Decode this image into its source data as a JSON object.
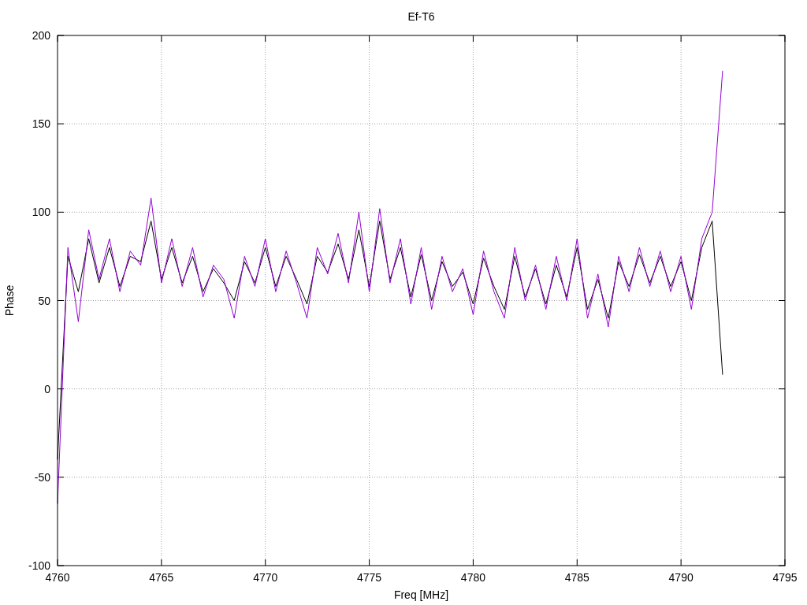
{
  "chart_data": {
    "type": "line",
    "title": "Ef-T6",
    "xlabel": "Freq [MHz]",
    "ylabel": "Phase",
    "x": [
      4760,
      4760.5,
      4761,
      4761.5,
      4762,
      4762.5,
      4763,
      4763.5,
      4764,
      4764.5,
      4765,
      4765.5,
      4766,
      4766.5,
      4767,
      4767.5,
      4768,
      4768.5,
      4769,
      4769.5,
      4770,
      4770.5,
      4771,
      4771.5,
      4772,
      4772.5,
      4773,
      4773.5,
      4774,
      4774.5,
      4775,
      4775.5,
      4776,
      4776.5,
      4777,
      4777.5,
      4778,
      4778.5,
      4779,
      4779.5,
      4780,
      4780.5,
      4781,
      4781.5,
      4782,
      4782.5,
      4783,
      4783.5,
      4784,
      4784.5,
      4785,
      4785.5,
      4786,
      4786.5,
      4787,
      4787.5,
      4788,
      4788.5,
      4789,
      4789.5,
      4790,
      4790.5,
      4791,
      4791.5,
      4792
    ],
    "series": [
      {
        "color": "#000000",
        "values": [
          -40,
          75,
          55,
          85,
          60,
          80,
          58,
          75,
          72,
          95,
          62,
          80,
          60,
          75,
          55,
          68,
          60,
          50,
          72,
          60,
          80,
          58,
          75,
          62,
          48,
          75,
          66,
          82,
          62,
          90,
          58,
          95,
          62,
          80,
          52,
          76,
          50,
          72,
          58,
          66,
          48,
          74,
          58,
          45,
          75,
          52,
          68,
          48,
          70,
          52,
          80,
          45,
          62,
          40,
          72,
          58,
          76,
          60,
          75,
          58,
          72,
          50,
          80,
          95,
          8
        ]
      },
      {
        "color": "#9400d3",
        "values": [
          -65,
          80,
          38,
          90,
          62,
          85,
          55,
          78,
          70,
          108,
          60,
          85,
          58,
          80,
          52,
          70,
          62,
          40,
          75,
          58,
          85,
          55,
          78,
          60,
          40,
          80,
          65,
          88,
          60,
          100,
          55,
          102,
          60,
          85,
          48,
          80,
          45,
          75,
          55,
          68,
          42,
          78,
          55,
          40,
          80,
          50,
          70,
          45,
          75,
          50,
          85,
          40,
          65,
          35,
          75,
          55,
          80,
          58,
          78,
          55,
          75,
          45,
          85,
          100,
          180
        ]
      }
    ],
    "grid": true,
    "xlim": [
      4760,
      4795
    ],
    "ylim": [
      -100,
      200
    ],
    "xticks": [
      4760,
      4765,
      4770,
      4775,
      4780,
      4785,
      4790,
      4795
    ],
    "yticks": [
      -100,
      -50,
      0,
      50,
      100,
      150,
      200
    ]
  }
}
